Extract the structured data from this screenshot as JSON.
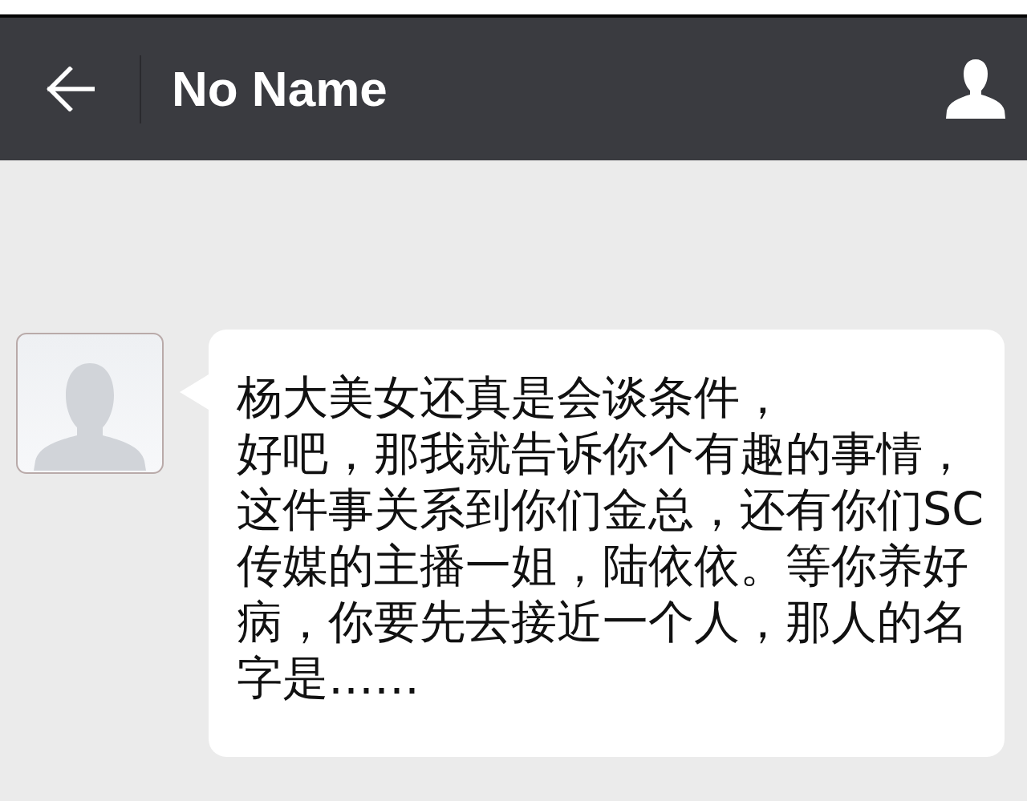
{
  "header": {
    "title": "No Name"
  },
  "messages": [
    {
      "kind": "incoming",
      "paragraphs": [
        "杨大美女还真是会谈条件，",
        "好吧，那我就告诉你个有趣的事情，这件事关系到你们金总，还有你们SC传媒的主播一姐，陆依依。等你养好病，你要先去接近一个人，那人的名字是……"
      ]
    }
  ]
}
